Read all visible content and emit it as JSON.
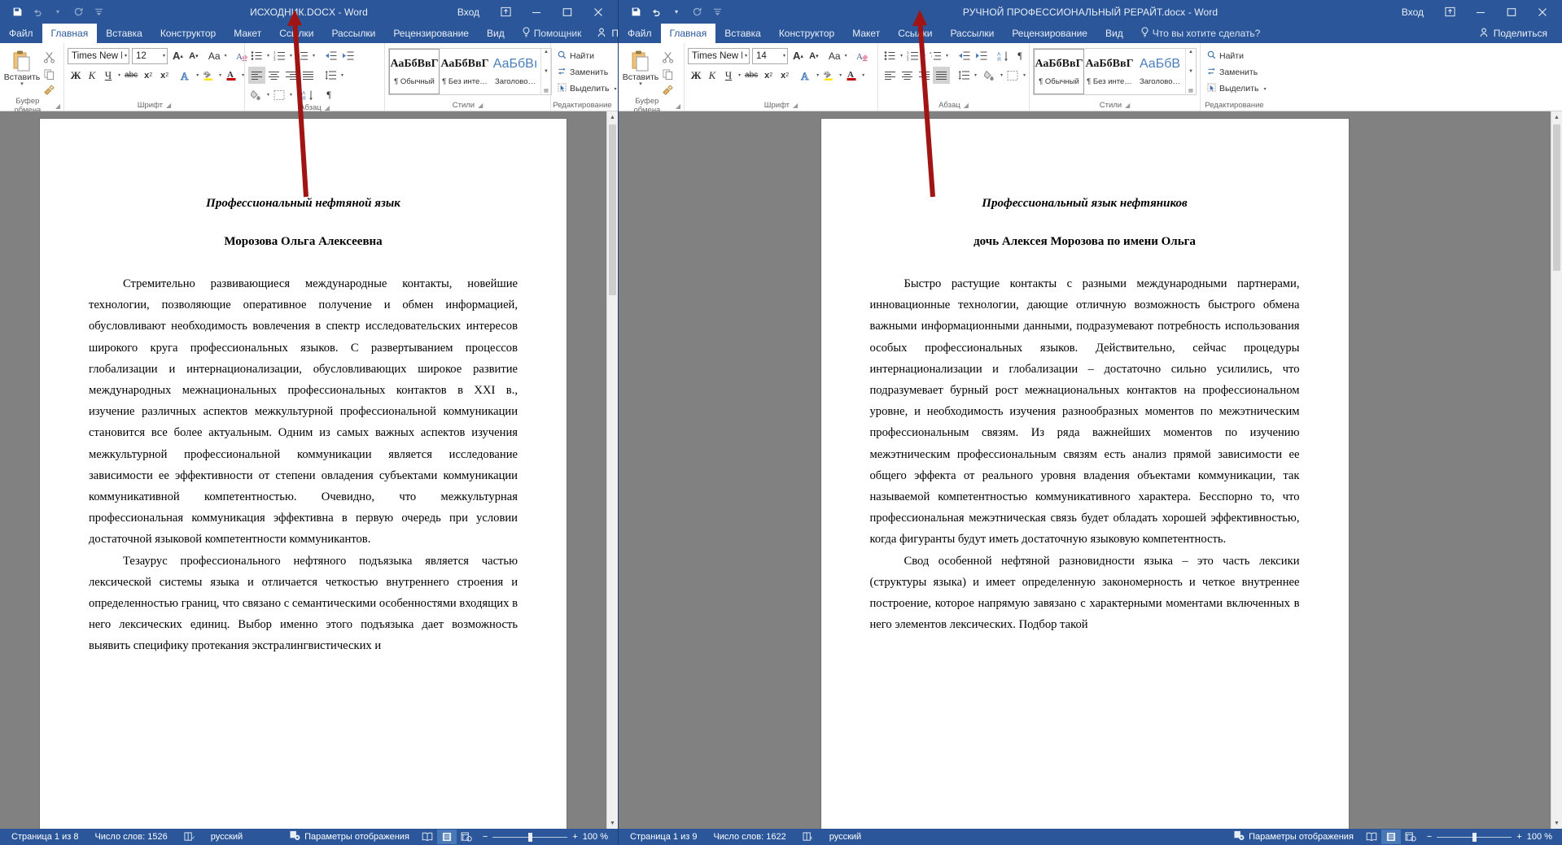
{
  "windows": [
    {
      "title": "ИСХОДНИК.DOCX  -  Word",
      "signin": "Вход",
      "qat": [
        "save-icon",
        "undo-icon",
        "redo-icon",
        "customize-qat-icon"
      ],
      "tabs": [
        "Файл",
        "Главная",
        "Вставка",
        "Конструктор",
        "Макет",
        "Ссылки",
        "Рассылки",
        "Рецензирование",
        "Вид"
      ],
      "active_tab": "Главная",
      "tell_me": "Помощник",
      "share": "Поделиться",
      "ribbon": {
        "clipboard": {
          "label": "Буфер обмена",
          "paste": "Вставить"
        },
        "font": {
          "label": "Шрифт",
          "font_name": "Times New R",
          "font_size": "12",
          "bold": "Ж",
          "italic": "К",
          "underline": "Ч",
          "strike": "abc",
          "subscript": "x",
          "superscript": "x",
          "text_effects": "A",
          "highlight": "ab",
          "font_color": "A",
          "grow": "A",
          "shrink": "A",
          "change_case": "Aa",
          "clear_format": "A"
        },
        "paragraph": {
          "label": "Абзац"
        },
        "styles": {
          "label": "Стили",
          "items": [
            {
              "sample": "АаБбВвГ",
              "name": "¶ Обычный",
              "selected": true
            },
            {
              "sample": "АаБбВвГ",
              "name": "¶ Без инте…",
              "selected": false
            },
            {
              "sample": "АаБбВı",
              "name": "Заголово…",
              "selected": false,
              "heading": true
            }
          ]
        },
        "editing": {
          "label": "Редактирование",
          "find": "Найти",
          "replace": "Заменить",
          "select": "Выделить"
        }
      },
      "document": {
        "title": "Профессиональный нефтяной язык",
        "author": "Морозова Ольга Алексеевна",
        "paragraphs": [
          "Стремительно развивающиеся международные контакты, новейшие технологии, позволяющие оперативное получение и обмен информацией, обусловливают необходимость вовлечения в спектр исследовательских интересов широкого круга профессиональных языков. С развертыванием процессов глобализации и интернационализации, обусловливающих широкое развитие международных межнациональных профессиональных контактов в XXI в., изучение различных аспектов межкультурной профессиональной коммуникации становится все более актуальным. Одним из самых важных аспектов изучения межкультурной профессиональной коммуникации является исследование зависимости ее эффективности от степени овладения субъектами коммуникации коммуникативной компетентностью. Очевидно, что межкультурная профессиональная коммуникация эффективна в первую очередь при условии достаточной языковой компетентности коммуникантов.",
          "Тезаурус профессионального нефтяного подъязыка является частью лексической системы языка и отличается четкостью внутреннего строения и определенностью границ, что связано с семантическими особенностями входящих в него лексических единиц. Выбор именно этого подъязыка дает возможность выявить специфику протекания экстралингвистических и"
        ]
      },
      "status": {
        "page": "Страница 1 из 8",
        "words": "Число слов: 1526",
        "proof_icon": "spellcheck-icon",
        "language": "русский",
        "display_options": "Параметры отображения",
        "views": [
          "read-mode-icon",
          "print-layout-icon",
          "web-layout-icon"
        ],
        "active_view": "print-layout-icon",
        "zoom": "100 %",
        "zoom_value": 100
      }
    },
    {
      "title": "РУЧНОЙ ПРОФЕССИОНАЛЬНЫЙ РЕРАЙТ.docx  -  Word",
      "signin": "Вход",
      "qat": [
        "save-icon",
        "undo-icon",
        "redo-icon",
        "customize-qat-icon"
      ],
      "tabs": [
        "Файл",
        "Главная",
        "Вставка",
        "Конструктор",
        "Макет",
        "Ссылки",
        "Рассылки",
        "Рецензирование",
        "Вид"
      ],
      "active_tab": "Главная",
      "tell_me": "Что вы хотите сделать?",
      "share": "Поделиться",
      "ribbon": {
        "clipboard": {
          "label": "Буфер обмена",
          "paste": "Вставить"
        },
        "font": {
          "label": "Шрифт",
          "font_name": "Times New R",
          "font_size": "14",
          "bold": "Ж",
          "italic": "К",
          "underline": "Ч",
          "strike": "abc",
          "subscript": "x",
          "superscript": "x",
          "text_effects": "A",
          "highlight": "ab",
          "font_color": "A",
          "grow": "A",
          "shrink": "A",
          "change_case": "Aa",
          "clear_format": "A"
        },
        "paragraph": {
          "label": "Абзац"
        },
        "styles": {
          "label": "Стили",
          "items": [
            {
              "sample": "АаБбВвГ",
              "name": "¶ Обычный",
              "selected": true
            },
            {
              "sample": "АаБбВвГ",
              "name": "¶ Без инте…",
              "selected": false
            },
            {
              "sample": "АаБбВ",
              "name": "Заголово…",
              "selected": false,
              "heading": true
            }
          ]
        },
        "editing": {
          "label": "Редактирование",
          "find": "Найти",
          "replace": "Заменить",
          "select": "Выделить"
        }
      },
      "document": {
        "title": "Профессиональный язык нефтяников",
        "author": "дочь Алексея Морозова по имени Ольга",
        "paragraphs": [
          "Быстро растущие контакты с разными международными партнерами, инновационные технологии, дающие отличную возможность быстрого обмена важными информационными данными, подразумевают потребность использования особых профессиональных языков. Действительно, сейчас процедуры интернационализации и глобализации – достаточно сильно усилились, что подразумевает бурный рост межнациональных контактов на профессиональном уровне, и необходимость изучения разнообразных моментов по межэтническим профессиональным связям. Из ряда важнейших моментов по изучению межэтническим профессиональным связям есть анализ прямой зависимости ее общего эффекта от реального уровня владения объектами коммуникации, так называемой компетентностью коммуникативного характера. Бесспорно то, что профессиональная межэтническая связь будет обладать хорошей эффективностью, когда фигуранты будут иметь достаточную языковую компетентность.",
          "Свод особенной нефтяной разновидности языка – это часть лексики (структуры языка) и имеет определенную закономерность и четкое внутреннее построение, которое напрямую завязано с характерными моментами включенных в него элементов лексических. Подбор такой"
        ]
      },
      "status": {
        "page": "Страница 1 из 9",
        "words": "Число слов: 1622",
        "proof_icon": "spellcheck-icon",
        "language": "русский",
        "display_options": "Параметры отображения",
        "views": [
          "read-mode-icon",
          "print-layout-icon",
          "web-layout-icon"
        ],
        "active_view": "print-layout-icon",
        "zoom": "100 %",
        "zoom_value": 100
      }
    }
  ],
  "annotations": {
    "color": "#a01414",
    "arrow_left": "arrow-pointing-to-left-document-title",
    "arrow_right": "arrow-pointing-to-right-document-title"
  }
}
